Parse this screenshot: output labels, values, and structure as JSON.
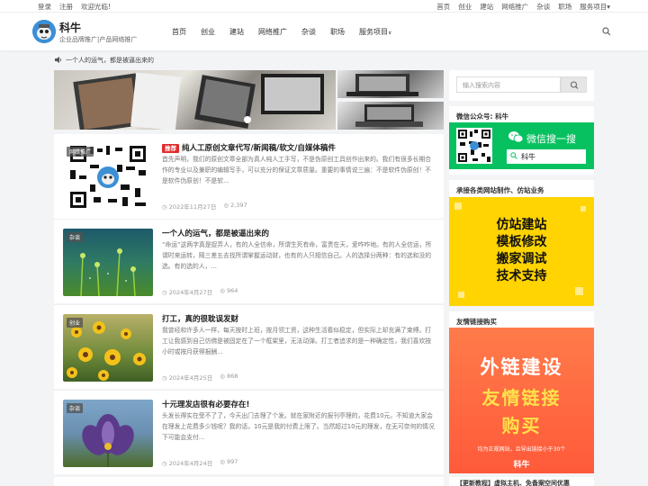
{
  "topbar": {
    "login": "登录",
    "register": "注册",
    "welcome": "欢迎光临!",
    "links": [
      "首页",
      "创业",
      "建站",
      "网络推广",
      "杂谈",
      "职场",
      "服务项目"
    ]
  },
  "header": {
    "title": "科牛",
    "subtitle": "企业品牌推广|产品网络推广",
    "nav": [
      "首页",
      "创业",
      "建站",
      "网络推广",
      "杂谈",
      "职场",
      "服务项目"
    ]
  },
  "notice": "一个人的运气，都是被逼出来的",
  "posts": [
    {
      "tag": "推荐",
      "title": "纯人工原创文章代写/新闻稿/软文/自媒体稿件",
      "thumb_label": "网络推广",
      "excerpt": "首先声明，我们的原创文章全部为真人纯人工手写，不是伪原创工具创作出来的。我们有很多长期合作的专业以及兼职的编辑写手，可以充分的保证文章质量。重要的事情说三遍：不是软件伪原创！不是软件伪原创！不是软...",
      "date": "2022年11月27日",
      "views": "2,397"
    },
    {
      "title": "一个人的运气，都是被逼出来的",
      "thumb_label": "杂谈",
      "excerpt": "“命运”这两字真是捉弄人，有的人全信命，所谓生死有命，富贵在天，爱咋咋地。有的人全信运，所谓时来运转，隔三差五去找所谓掌握运动财，也有的人只相信自己。人的选择分两种：有的选和没的选。有的选的人，...",
      "date": "2024年4月27日",
      "views": "964"
    },
    {
      "title": "打工，真的很耽误发财",
      "thumb_label": "创业",
      "excerpt": "我曾经和许多人一样，每天按时上班，按月领工资，这种生活看似稳定，但实际上却充满了束缚。打工让我感到自己仿佛是被固定在了一个框架里，无法动弹。打工者追求的是一种确定性，我们喜欢按小时或按月获得报酬...",
      "date": "2024年4月25日",
      "views": "868"
    },
    {
      "title": "十元理发店很有必要存在!",
      "thumb_label": "杂谈",
      "excerpt": "头发长得实在受不了了，今天出门去理了个发。就在家附近的报刊亭理的，花费10元。不知道大家会在理发上花费多少钱呢？我的话，10元是我的付费上限了。当然超过10元的理发，在无可奈何的情况下可能会支付...",
      "date": "2024年4月24日",
      "views": "997"
    }
  ],
  "sidebar": {
    "search_placeholder": "输入搜索内容",
    "wechat_title": "微信公众号: 科牛",
    "wechat_search": "微信搜一搜",
    "wechat_name": "科牛",
    "service_title": "承接各类网站制作、仿站业务",
    "service_lines": [
      "仿站建站",
      "模板修改",
      "搬家调试",
      "技术支持"
    ],
    "links_title": "友情链接购买",
    "links_line1": "外链建设",
    "links_line2": "友情链接",
    "links_line3": "购买",
    "links_note": "均为正规网站，且导出链接小于30个",
    "links_brand": "科牛",
    "bottom_title": "【更新教程】虚拟主机、免备案空间优惠"
  },
  "colors": {
    "accent_red": "#e02b2b",
    "wechat_green": "#07c160",
    "yellow": "#ffd400",
    "orange": "#ff6b3d"
  }
}
